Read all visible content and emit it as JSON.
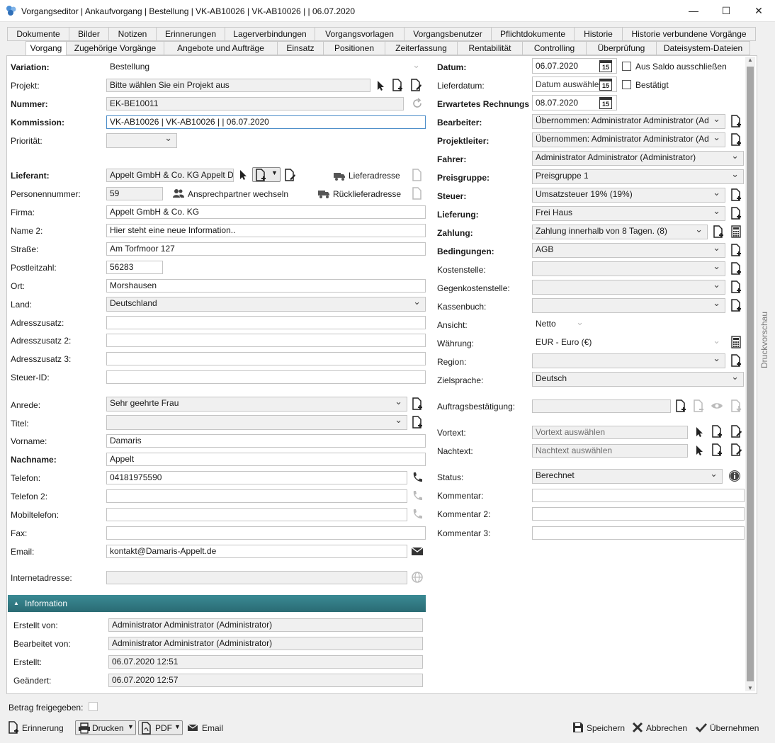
{
  "window": {
    "title": "Vorgangseditor | Ankaufvorgang | Bestellung | VK-AB10026 | VK-AB10026 |  | 06.07.2020",
    "minimize": "—",
    "maximize": "☐",
    "close": "✕"
  },
  "tabs_row1": [
    "Dokumente",
    "Bilder",
    "Notizen",
    "Erinnerungen",
    "Lagerverbindungen",
    "Vorgangsvorlagen",
    "Vorgangsbenutzer",
    "Pflichtdokumente",
    "Historie",
    "Historie verbundene Vorgänge"
  ],
  "tabs_row2": [
    "Vorgang",
    "Zugehörige Vorgänge",
    "Angebote und Aufträge",
    "Einsatz",
    "Positionen",
    "Zeiterfassung",
    "Rentabilität",
    "Controlling",
    "Überprüfung",
    "Dateisystem-Dateien"
  ],
  "left": {
    "variation_label": "Variation:",
    "variation_value": "Bestellung",
    "projekt_label": "Projekt:",
    "projekt_value": "Bitte wählen Sie ein Projekt aus",
    "nummer_label": "Nummer:",
    "nummer_value": "EK-BE10011",
    "kommission_label": "Kommission:",
    "kommission_value": "VK-AB10026 | VK-AB10026 |  | 06.07.2020",
    "prioritaet_label": "Priorität:",
    "prioritaet_value": "",
    "lieferant_label": "Lieferant:",
    "lieferant_value": "Appelt GmbH & Co. KG Appelt Da",
    "lieferadresse": "Lieferadresse",
    "personennummer_label": "Personennummer:",
    "personennummer_value": "59",
    "ansprechpartner": "Ansprechpartner wechseln",
    "ruecklieferadresse": "Rücklieferadresse",
    "firma_label": "Firma:",
    "firma_value": "Appelt GmbH & Co. KG",
    "name2_label": "Name 2:",
    "name2_value": "Hier steht eine neue Information..",
    "strasse_label": "Straße:",
    "strasse_value": "Am Torfmoor 127",
    "plz_label": "Postleitzahl:",
    "plz_value": "56283",
    "ort_label": "Ort:",
    "ort_value": "Morshausen",
    "land_label": "Land:",
    "land_value": "Deutschland",
    "adresszusatz_label": "Adresszusatz:",
    "adresszusatz2_label": "Adresszusatz 2:",
    "adresszusatz3_label": "Adresszusatz 3:",
    "steuerid_label": "Steuer-ID:",
    "anrede_label": "Anrede:",
    "anrede_value": "Sehr geehrte Frau",
    "titel_label": "Titel:",
    "vorname_label": "Vorname:",
    "vorname_value": "Damaris",
    "nachname_label": "Nachname:",
    "nachname_value": "Appelt",
    "telefon_label": "Telefon:",
    "telefon_value": "04181975590",
    "telefon2_label": "Telefon 2:",
    "mobil_label": "Mobiltelefon:",
    "fax_label": "Fax:",
    "email_label": "Email:",
    "email_value": "kontakt@Damaris-Appelt.de",
    "internet_label": "Internetadresse:"
  },
  "info": {
    "header": "Information",
    "erstellt_von_label": "Erstellt von:",
    "erstellt_von_value": "Administrator Administrator (Administrator)",
    "bearbeitet_von_label": "Bearbeitet von:",
    "bearbeitet_von_value": "Administrator Administrator (Administrator)",
    "erstellt_label": "Erstellt:",
    "erstellt_value": "06.07.2020 12:51",
    "geaendert_label": "Geändert:",
    "geaendert_value": "06.07.2020 12:57"
  },
  "right": {
    "datum_label": "Datum:",
    "datum_value": "06.07.2020",
    "aus_saldo": "Aus Saldo ausschließen",
    "lieferdatum_label": "Lieferdatum:",
    "lieferdatum_placeholder": "Datum auswähle",
    "bestaetigt": "Bestätigt",
    "erw_rechnung_label": "Erwartetes Rechnungsd",
    "erw_rechnung_value": "08.07.2020",
    "cal_day": "15",
    "bearbeiter_label": "Bearbeiter:",
    "bearbeiter_value": "Übernommen: Administrator Administrator (Ad",
    "projektleiter_label": "Projektleiter:",
    "projektleiter_value": "Übernommen: Administrator Administrator (Ad",
    "fahrer_label": "Fahrer:",
    "fahrer_value": "Administrator Administrator (Administrator)",
    "preisgruppe_label": "Preisgruppe:",
    "preisgruppe_value": "Preisgruppe 1",
    "steuer_label": "Steuer:",
    "steuer_value": "Umsatzsteuer 19% (19%)",
    "lieferung_label": "Lieferung:",
    "lieferung_value": "Frei Haus",
    "zahlung_label": "Zahlung:",
    "zahlung_value": "Zahlung innerhalb von 8 Tagen. (8)",
    "bedingungen_label": "Bedingungen:",
    "bedingungen_value": "AGB",
    "kostenstelle_label": "Kostenstelle:",
    "gegenkostenstelle_label": "Gegenkostenstelle:",
    "kassenbuch_label": "Kassenbuch:",
    "ansicht_label": "Ansicht:",
    "ansicht_value": "Netto",
    "waehrung_label": "Währung:",
    "waehrung_value": "EUR - Euro (€)",
    "region_label": "Region:",
    "zielsprache_label": "Zielsprache:",
    "zielsprache_value": "Deutsch",
    "auftragsbestaetigung_label": "Auftragsbestätigung:",
    "vortext_label": "Vortext:",
    "vortext_placeholder": "Vortext auswählen",
    "nachtext_label": "Nachtext:",
    "nachtext_placeholder": "Nachtext auswählen",
    "status_label": "Status:",
    "status_value": "Berechnet",
    "kommentar_label": "Kommentar:",
    "kommentar2_label": "Kommentar 2:",
    "kommentar3_label": "Kommentar 3:"
  },
  "side_tab": "Druckvorschau",
  "bottom": {
    "betrag_freigegeben": "Betrag freigegeben:",
    "erinnerung": "Erinnerung",
    "drucken": "Drucken",
    "pdf": "PDF",
    "email": "Email",
    "speichern": "Speichern",
    "abbrechen": "Abbrechen",
    "uebernehmen": "Übernehmen"
  }
}
